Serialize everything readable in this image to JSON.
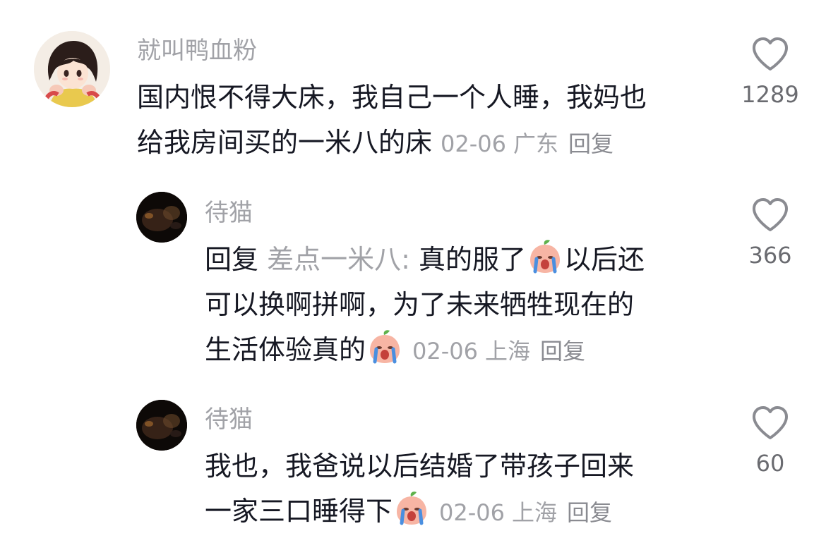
{
  "comments": [
    {
      "username": "就叫鸭血粉",
      "lines": [
        "国内恨不得大床，我自己一个人睡，我妈也",
        "给我房间买的一米八的床"
      ],
      "date": "02-06",
      "location": "广东",
      "reply_label": "回复",
      "likes": "1289",
      "avatar": "anime-girl-avatar"
    },
    {
      "username": "待猫",
      "reply_prefix": "回复",
      "reply_target": "差点一米八:",
      "line1_text": " 真的服了",
      "line1_after": "以后还",
      "line2": "可以换啊拼啊，为了未来牺牲现在的",
      "line3": "生活体验真的",
      "date": "02-06",
      "location": "上海",
      "reply_label": "回复",
      "likes": "366",
      "avatar": "dark-photo-avatar",
      "emoji": "crying-peach-emoji"
    },
    {
      "username": "待猫",
      "line1": "我也，我爸说以后结婚了带孩子回来",
      "line2": "一家三口睡得下",
      "date": "02-06",
      "location": "上海",
      "reply_label": "回复",
      "likes": "60",
      "avatar": "dark-photo-avatar",
      "emoji": "crying-peach-emoji"
    }
  ],
  "colors": {
    "text": "#161823",
    "secondary": "#a1a2a7",
    "heart_outline": "#8a8b91"
  }
}
